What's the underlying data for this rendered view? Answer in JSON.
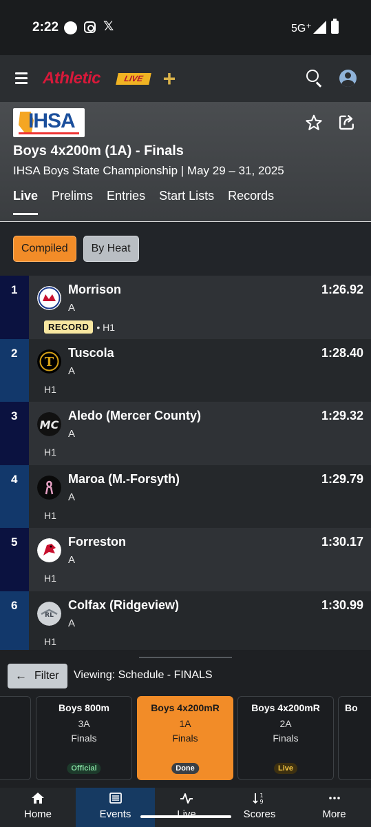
{
  "status_bar": {
    "time": "2:22",
    "network": "5G⁺",
    "x_glyph": "𝕏"
  },
  "app": {
    "logo_main": "Athletic",
    "logo_live": "LIVE",
    "logo_plus": "+"
  },
  "event": {
    "org_logo_text": "IHSA",
    "title": "Boys 4x200m (1A) - Finals",
    "subtitle": "IHSA Boys State Championship | May 29 – 31, 2025",
    "tabs": [
      "Live",
      "Prelims",
      "Entries",
      "Start Lists",
      "Records"
    ]
  },
  "view_toggle": {
    "compiled": "Compiled",
    "by_heat": "By Heat"
  },
  "results": [
    {
      "place": "1",
      "team": "Morrison",
      "relay": "A",
      "time": "1:26.92",
      "badge": "RECORD",
      "heat": "• H1",
      "logo_color": "#c8102e",
      "place_bg": "#0b1240"
    },
    {
      "place": "2",
      "team": "Tuscola",
      "relay": "A",
      "time": "1:28.40",
      "badge": "",
      "heat": "H1",
      "logo_color": "#d4a017",
      "place_bg": "#12386b"
    },
    {
      "place": "3",
      "team": "Aledo (Mercer County)",
      "relay": "A",
      "time": "1:29.32",
      "badge": "",
      "heat": "H1",
      "logo_color": "#1f5e3a",
      "place_bg": "#0b1240"
    },
    {
      "place": "4",
      "team": "Maroa (M.-Forsyth)",
      "relay": "A",
      "time": "1:29.79",
      "badge": "",
      "heat": "H1",
      "logo_color": "#e7a1c4",
      "place_bg": "#12386b"
    },
    {
      "place": "5",
      "team": "Forreston",
      "relay": "A",
      "time": "1:30.17",
      "badge": "",
      "heat": "H1",
      "logo_color": "#c8102e",
      "place_bg": "#0b1240"
    },
    {
      "place": "6",
      "team": "Colfax (Ridgeview)",
      "relay": "A",
      "time": "1:30.99",
      "badge": "",
      "heat": "H1",
      "logo_color": "#9aa3ab",
      "place_bg": "#12386b"
    }
  ],
  "schedule": {
    "filter_label": "Filter",
    "viewing": "Viewing: Schedule - FINALS",
    "cards": [
      {
        "title": "Boys 800m",
        "division": "3A",
        "round": "Finals",
        "status": "Official"
      },
      {
        "title": "Boys 4x200mR",
        "division": "1A",
        "round": "Finals",
        "status": "Done"
      },
      {
        "title": "Boys 4x200mR",
        "division": "2A",
        "round": "Finals",
        "status": "Live"
      },
      {
        "title": "Bo",
        "division": "",
        "round": "",
        "status": ""
      }
    ]
  },
  "bottom_nav": [
    "Home",
    "Events",
    "Live",
    "Scores",
    "More"
  ],
  "colors": {
    "accent": "#f28c28",
    "nav_active": "#163a62",
    "record_badge": "#f7e7a1"
  }
}
